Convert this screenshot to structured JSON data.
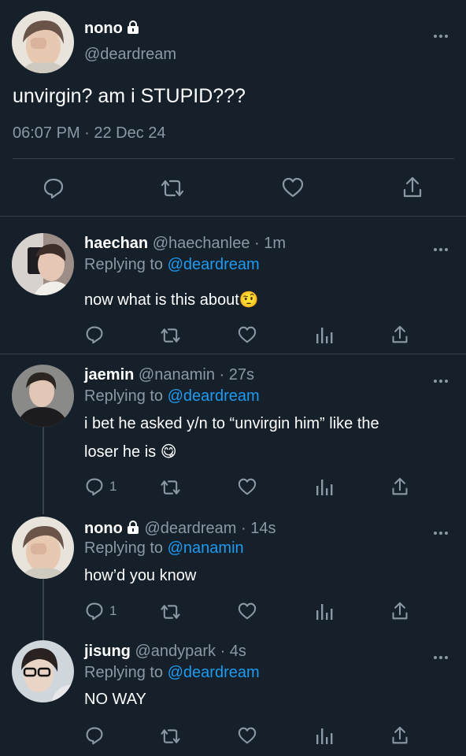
{
  "main_tweet": {
    "name": "nono",
    "handle": "@deardream",
    "text": "unvirgin? am i STUPID???",
    "timestamp": "06:07 PM · 22 Dec 24"
  },
  "replies": [
    {
      "name": "haechan",
      "handle": "@haechanlee",
      "time": "· 1m",
      "replying_prefix": "Replying to",
      "replying_to": "@deardream",
      "text": "now what is this about🤨",
      "reply_count": ""
    },
    {
      "name": "jaemin",
      "handle": "@nanamin",
      "time": "· 27s",
      "replying_prefix": "Replying to",
      "replying_to": "@deardream",
      "text_line1": "i bet he asked y/n to “unvirgin him” like the",
      "text_line2": "loser he is 😋",
      "reply_count": "1"
    },
    {
      "name": "nono",
      "handle": "@deardream",
      "time": "· 14s",
      "replying_prefix": "Replying to",
      "replying_to": "@nanamin",
      "text": "how’d you know",
      "reply_count": "1"
    },
    {
      "name": "jisung",
      "handle": "@andypark",
      "time": "· 4s",
      "replying_prefix": "Replying to",
      "replying_to": "@deardream",
      "text": "NO WAY",
      "reply_count": ""
    }
  ],
  "colors": {
    "background": "#15202b",
    "muted": "#8b98a5",
    "link": "#1d9bf0",
    "divider": "#38444d"
  }
}
